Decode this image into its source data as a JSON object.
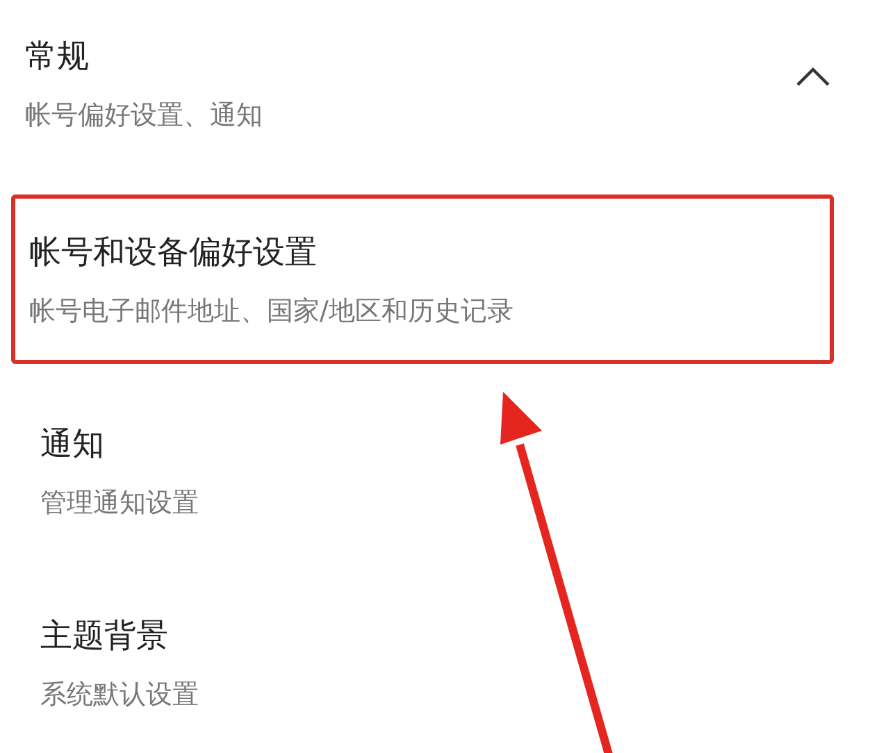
{
  "section": {
    "title": "常规",
    "subtitle": "帐号偏好设置、通知",
    "expanded": true
  },
  "items": [
    {
      "title": "帐号和设备偏好设置",
      "subtitle": "帐号电子邮件地址、国家/地区和历史记录",
      "highlighted": true
    },
    {
      "title": "通知",
      "subtitle": "管理通知设置",
      "highlighted": false
    },
    {
      "title": "主题背景",
      "subtitle": "系统默认设置",
      "highlighted": false
    }
  ]
}
